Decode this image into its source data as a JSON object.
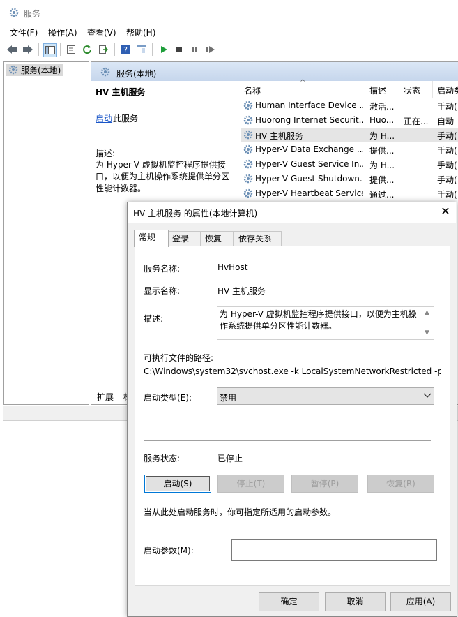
{
  "window": {
    "title": "服务",
    "icon": "gear-icon"
  },
  "menu": [
    "文件(F)",
    "操作(A)",
    "查看(V)",
    "帮助(H)"
  ],
  "left_pane": {
    "item": "服务(本地)"
  },
  "right_pane": {
    "header": "服务(本地)",
    "selected_service": "HV 主机服务",
    "start_link": "启动",
    "start_rest": "此服务",
    "desc_label": "描述:",
    "desc_text": "为 Hyper-V 虚拟机监控程序提供接口，以便为主机操作系统提供单分区性能计数器。",
    "bottom_tab": "扩展",
    "bottom_tab2": "标"
  },
  "service_list": {
    "columns": [
      "名称",
      "描述",
      "状态",
      "启动类"
    ],
    "rows": [
      {
        "name": "Human Interface Device ...",
        "desc": "激活...",
        "status": "",
        "startup": "手动("
      },
      {
        "name": "Huorong Internet Securit...",
        "desc": "Huo...",
        "status": "正在...",
        "startup": "自动"
      },
      {
        "name": "HV 主机服务",
        "desc": "为 H...",
        "status": "",
        "startup": "手动("
      },
      {
        "name": "Hyper-V Data Exchange ...",
        "desc": "提供...",
        "status": "",
        "startup": "手动("
      },
      {
        "name": "Hyper-V Guest Service In...",
        "desc": "为 H...",
        "status": "",
        "startup": "手动("
      },
      {
        "name": "Hyper-V Guest Shutdown...",
        "desc": "提供...",
        "status": "",
        "startup": "手动("
      },
      {
        "name": "Hyper-V Heartbeat Service",
        "desc": "通过...",
        "status": "",
        "startup": "手动("
      }
    ]
  },
  "dialog": {
    "title": "HV 主机服务 的属性(本地计算机)",
    "close": "✕",
    "tabs": [
      "常规",
      "登录",
      "恢复",
      "依存关系"
    ],
    "service_name_label": "服务名称:",
    "service_name": "HvHost",
    "display_name_label": "显示名称:",
    "display_name": "HV 主机服务",
    "desc_label": "描述:",
    "desc": "为 Hyper-V 虚拟机监控程序提供接口，以便为主机操作系统提供单分区性能计数器。",
    "path_label": "可执行文件的路径:",
    "path": "C:\\Windows\\system32\\svchost.exe -k LocalSystemNetworkRestricted -p",
    "startup_type_label": "启动类型(E):",
    "startup_type": "禁用",
    "status_label": "服务状态:",
    "status": "已停止",
    "buttons": {
      "start": "启动(S)",
      "stop": "停止(T)",
      "pause": "暂停(P)",
      "resume": "恢复(R)"
    },
    "hint": "当从此处启动服务时，你可指定所适用的启动参数。",
    "param_label": "启动参数(M):",
    "param_value": "",
    "footer": {
      "ok": "确定",
      "cancel": "取消",
      "apply": "应用(A)"
    }
  }
}
